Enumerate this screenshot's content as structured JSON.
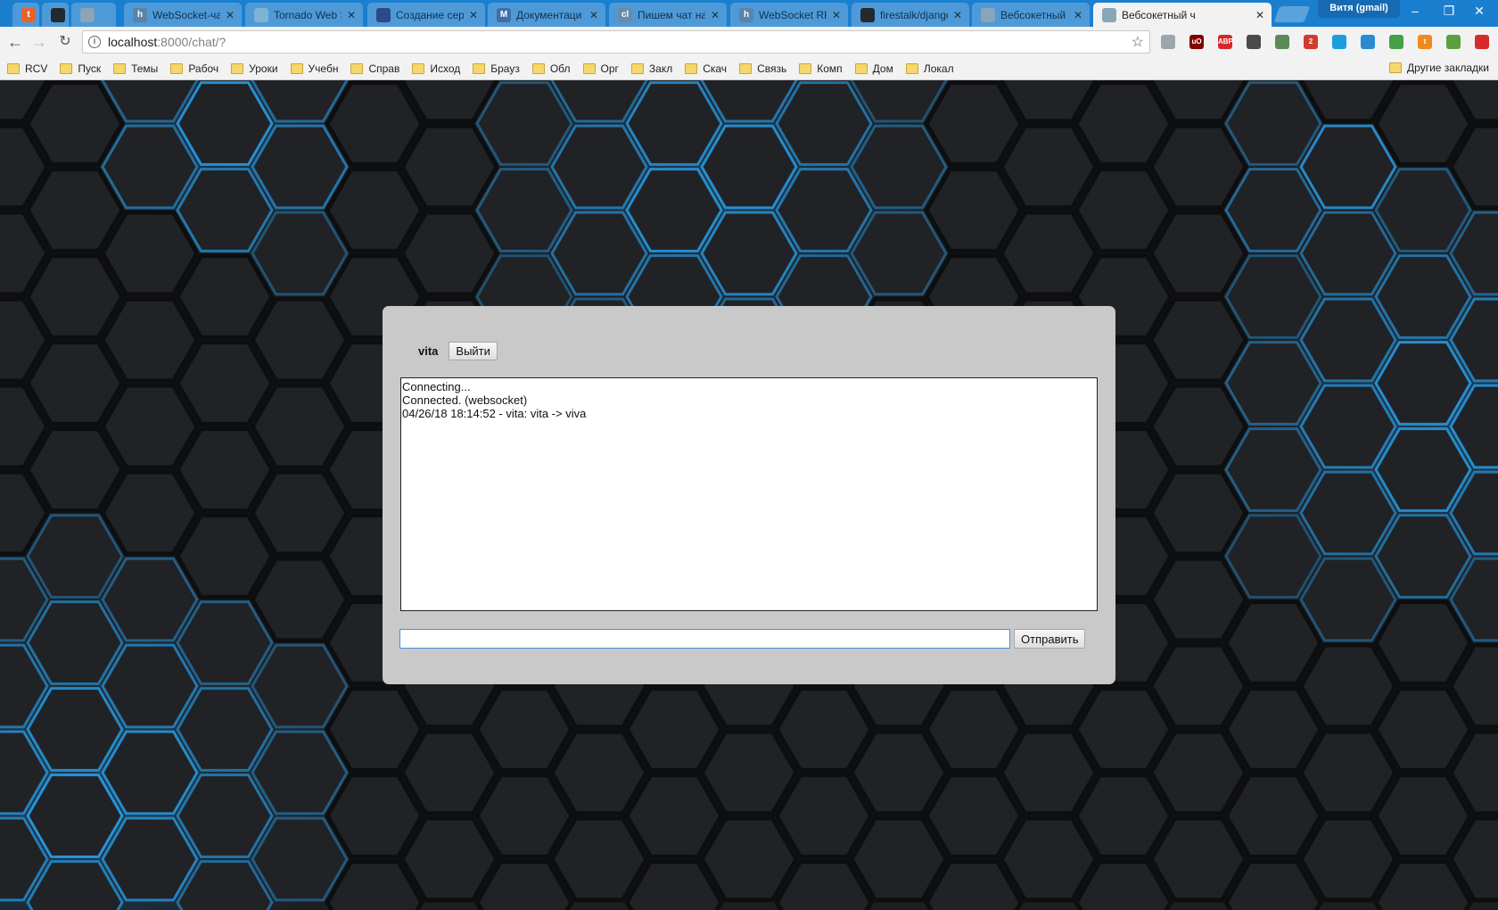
{
  "browser": {
    "tabs": [
      {
        "title": "",
        "favicon": "t",
        "favicon_color": "#e8632b",
        "active": false
      },
      {
        "title": "",
        "favicon": "github",
        "favicon_color": "#24292e",
        "active": false
      },
      {
        "title": "",
        "favicon": "doc",
        "favicon_color": "#8aa4b8",
        "active": false
      },
      {
        "title": "WebSocket-чат",
        "favicon": "h",
        "favicon_color": "#5a84a8",
        "active": false
      },
      {
        "title": "Tornado Web S",
        "favicon": "tornado",
        "favicon_color": "#7fb3d5",
        "active": false
      },
      {
        "title": "Создание серв",
        "favicon": "doc-blue",
        "favicon_color": "#2c4a8a",
        "active": false
      },
      {
        "title": "Документаци",
        "favicon": "M",
        "favicon_color": "#3f6fa6",
        "active": false
      },
      {
        "title": "Пишем чат на",
        "favicon": "cl",
        "favicon_color": "#6b8ba6",
        "active": false
      },
      {
        "title": "WebSocket RPC",
        "favicon": "h",
        "favicon_color": "#5a84a8",
        "active": false
      },
      {
        "title": "firestalk/django",
        "favicon": "github",
        "favicon_color": "#24292e",
        "active": false
      },
      {
        "title": "Вебсокетный ч",
        "favicon": "doc",
        "favicon_color": "#8aa4b8",
        "active": false
      },
      {
        "title": "Вебсокетный ч",
        "favicon": "doc",
        "favicon_color": "#8aa4b8",
        "active": true
      }
    ],
    "profile_name": "Витя (gmail)",
    "url_host": "localhost",
    "url_rest": ":8000/chat/?",
    "bookmarks": [
      "RCV",
      "Пуск",
      "Темы",
      "Рабоч",
      "Уроки",
      "Учебн",
      "Справ",
      "Исход",
      "Брауз",
      "Обл",
      "Орг",
      "Закл",
      "Скач",
      "Связь",
      "Комп",
      "Дом",
      "Локал"
    ],
    "other_bookmarks": "Другие закладки",
    "extensions": [
      {
        "name": "globe-icon",
        "color": "#9aa6ae",
        "label": ""
      },
      {
        "name": "ublock-icon",
        "color": "#800000",
        "label": "uO"
      },
      {
        "name": "adblock-icon",
        "color": "#d3272a",
        "label": "ABP"
      },
      {
        "name": "pocket-icon",
        "color": "#4a4a4a",
        "label": ""
      },
      {
        "name": "evernote-icon",
        "color": "#5b8a58",
        "label": ""
      },
      {
        "name": "calendar-icon",
        "color": "#d23a2e",
        "label": "2"
      },
      {
        "name": "refresh-ext-icon",
        "color": "#1b9ee0",
        "label": ""
      },
      {
        "name": "xmarks-icon",
        "color": "#2a8bd4",
        "label": ""
      },
      {
        "name": "battery-icon",
        "color": "#46a046",
        "label": ""
      },
      {
        "name": "t-ext-icon",
        "color": "#f08a1c",
        "label": "t"
      },
      {
        "name": "photo-ext-icon",
        "color": "#5aa03c",
        "label": ""
      },
      {
        "name": "upload-ext-icon",
        "color": "#d42b2b",
        "label": ""
      }
    ]
  },
  "chat": {
    "username": "vita",
    "logout_label": "Выйти",
    "log_lines": [
      "Connecting...",
      "Connected. (websocket)",
      "04/26/18 18:14:52 - vita: vita -> viva"
    ],
    "message_value": "",
    "send_label": "Отправить"
  }
}
